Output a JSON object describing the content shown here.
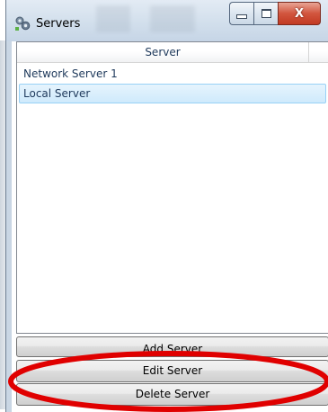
{
  "window": {
    "title": "Servers",
    "icon": "servers-app-icon",
    "controls": {
      "minimize_icon": "minimize-icon",
      "maximize_icon": "maximize-icon",
      "close_glyph": "X"
    }
  },
  "server_list": {
    "columns": [
      "Server"
    ],
    "rows": [
      {
        "name": "Network Server 1",
        "selected": false
      },
      {
        "name": "Local Server",
        "selected": true
      }
    ]
  },
  "buttons": {
    "add_label": "Add Server",
    "edit_label": "Edit Server",
    "delete_label": "Delete Server"
  },
  "colors": {
    "selection_fill": "#cfeafc",
    "selection_border": "#98d1f6",
    "annotation": "#e00000",
    "close_button": "#c23a22"
  }
}
